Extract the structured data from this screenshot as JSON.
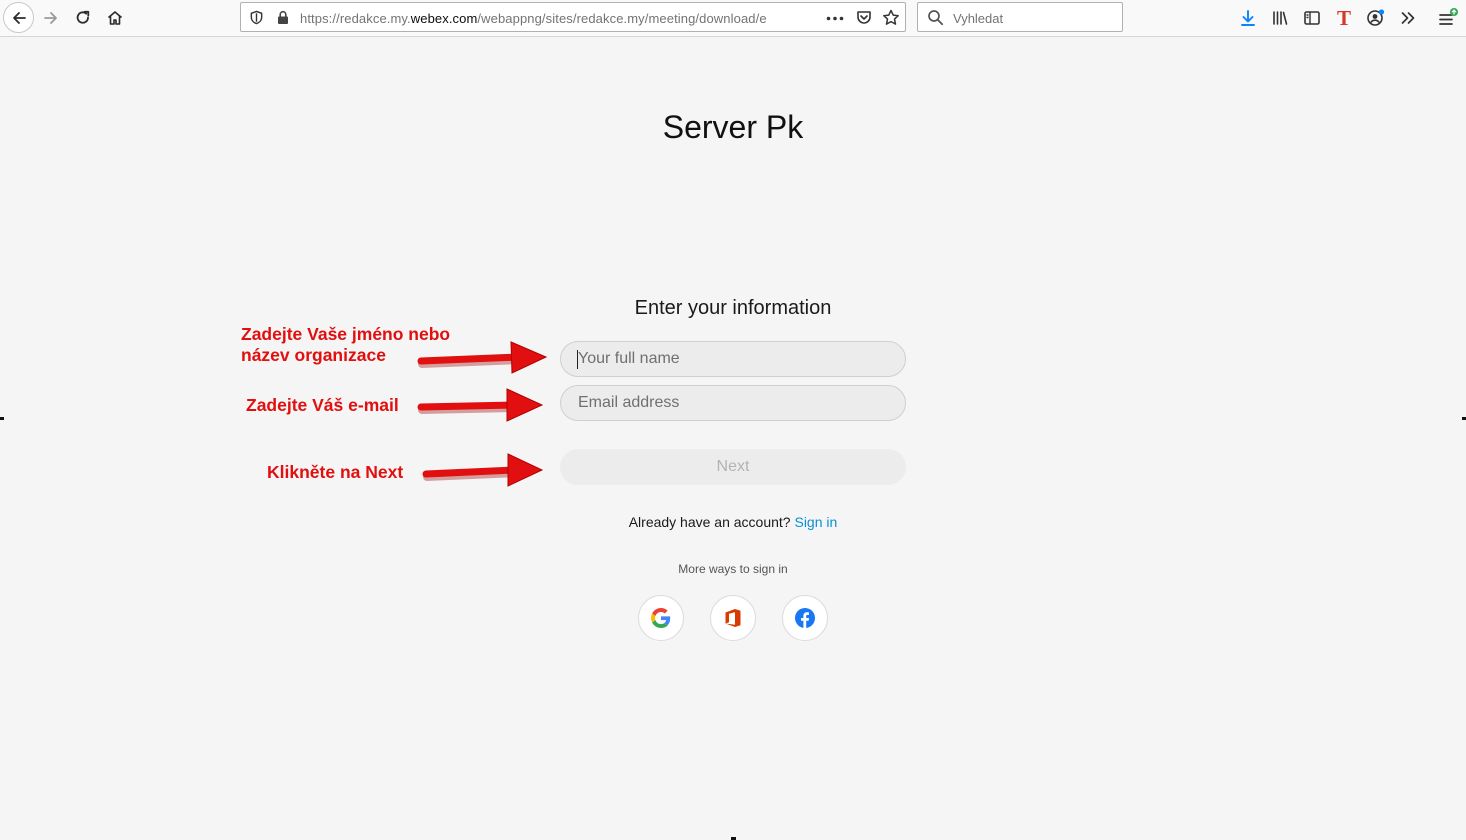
{
  "browser": {
    "url_prefix": "https://redakce.my.",
    "url_domain": "webex.com",
    "url_path": "/webappng/sites/redakce.my/meeting/download/e",
    "search_placeholder": "Vyhledat",
    "extension_letter": "T"
  },
  "page": {
    "title": "Server Pk",
    "form_heading": "Enter your information",
    "name_placeholder": "Your full name",
    "email_placeholder": "Email address",
    "next_label": "Next",
    "account_prompt": "Already have an account?",
    "signin_label": "Sign in",
    "more_ways": "More ways to sign in"
  },
  "annotations": {
    "name_note": "Zadejte Vaše jméno nebo název organizace",
    "email_note": "Zadejte Váš e-mail",
    "next_note": "Klikněte na Next"
  },
  "colors": {
    "annotation": "#e10f0f",
    "link": "#0a8fd4",
    "download_icon": "#0a84ff"
  },
  "icons": [
    "back-arrow-icon",
    "forward-arrow-icon",
    "reload-icon",
    "home-icon",
    "shield-icon",
    "lock-icon",
    "more-dots-icon",
    "pocket-icon",
    "bookmark-star-icon",
    "search-icon",
    "download-icon",
    "library-icon",
    "sidebar-icon",
    "account-icon",
    "overflow-chevrons-icon",
    "menu-icon",
    "google-icon",
    "office-icon",
    "facebook-icon"
  ]
}
